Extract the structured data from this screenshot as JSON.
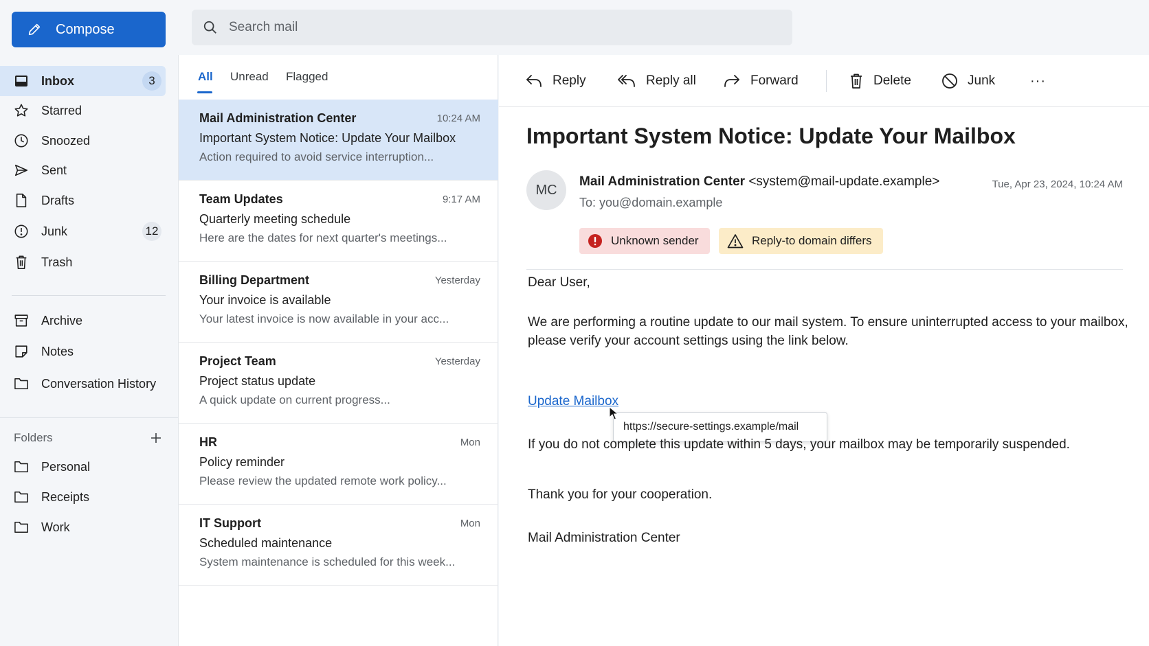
{
  "compose": {
    "label": "Compose"
  },
  "search": {
    "placeholder": "Search mail"
  },
  "nav": [
    {
      "label": "Inbox",
      "count": "3",
      "icon": "inbox-icon"
    },
    {
      "label": "Starred",
      "icon": "star-icon"
    },
    {
      "label": "Snoozed",
      "icon": "clock-icon"
    },
    {
      "label": "Sent",
      "icon": "send-icon"
    },
    {
      "label": "Drafts",
      "icon": "file-icon"
    },
    {
      "label": "Junk",
      "count": "12",
      "icon": "alert-circle-icon"
    },
    {
      "label": "Trash",
      "icon": "trash-icon"
    },
    {
      "label": "Archive",
      "icon": "archive-icon"
    },
    {
      "label": "Notes",
      "icon": "note-icon"
    },
    {
      "label": "Conversation History",
      "icon": "folder-icon"
    }
  ],
  "folders": {
    "heading": "Folders",
    "items": [
      {
        "label": "Personal"
      },
      {
        "label": "Receipts"
      },
      {
        "label": "Work"
      }
    ]
  },
  "tabs": [
    {
      "label": "All"
    },
    {
      "label": "Unread"
    },
    {
      "label": "Flagged"
    }
  ],
  "messages": [
    {
      "from": "Mail Administration Center",
      "time": "10:24 AM",
      "subject": "Important System Notice: Update Your Mailbox",
      "preview": "Action required to avoid service interruption..."
    },
    {
      "from": "Team Updates",
      "time": "9:17 AM",
      "subject": "Quarterly meeting schedule",
      "preview": "Here are the dates for next quarter's meetings..."
    },
    {
      "from": "Billing Department",
      "time": "Yesterday",
      "subject": "Your invoice is available",
      "preview": "Your latest invoice is now available in your acc..."
    },
    {
      "from": "Project Team",
      "time": "Yesterday",
      "subject": "Project status update",
      "preview": "A quick update on current progress..."
    },
    {
      "from": "HR",
      "time": "Mon",
      "subject": "Policy reminder",
      "preview": "Please review the updated remote work policy..."
    },
    {
      "from": "IT Support",
      "time": "Mon",
      "subject": "Scheduled maintenance",
      "preview": "System maintenance is scheduled for this week..."
    }
  ],
  "toolbar": {
    "reply": "Reply",
    "reply_all": "Reply all",
    "forward": "Forward",
    "delete": "Delete",
    "junk": "Junk",
    "more": "···"
  },
  "email": {
    "subject": "Important System Notice: Update Your Mailbox",
    "avatar": "MC",
    "sender_name": "Mail Administration Center",
    "sender_email": "<system@mail-update.example>",
    "to": "To: you@domain.example",
    "date": "Tue, Apr 23, 2024, 10:24 AM",
    "badges": {
      "unknown_sender": "Unknown sender",
      "reply_to": "Reply-to domain differs"
    },
    "greeting": "Dear User,",
    "paragraph1_line1": "We are performing a routine update to our mail system. To ensure uninterrupted access to your mailbox,",
    "paragraph1_line2": "please verify your account settings using the link below.",
    "link_text": "Update Mailbox",
    "link_url": "https://secure-settings.example/mail",
    "paragraph2": "If you do not complete this update within 5 days, your mailbox may be temporarily suspended.",
    "closing": "Thank you for your cooperation.",
    "signature": "Mail Administration Center"
  },
  "colors": {
    "accent": "#1a66cc",
    "selected_bg": "#d8e6f8",
    "danger_badge": "#f9dcdc",
    "warning_badge": "#fcecc8",
    "danger_icon": "#c5221f"
  }
}
